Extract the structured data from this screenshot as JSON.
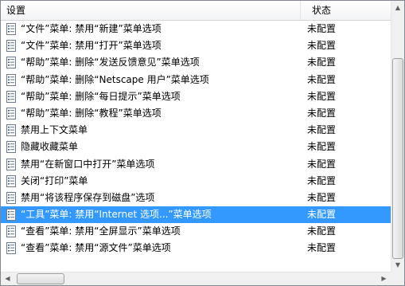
{
  "columns": {
    "setting": "设置",
    "status": "状态"
  },
  "rows": [
    {
      "label": "“文件”菜单: 禁用“新建”菜单选项",
      "status": "未配置"
    },
    {
      "label": "“文件”菜单: 禁用“打开”菜单选项",
      "status": "未配置"
    },
    {
      "label": "“帮助”菜单: 删除“发送反馈意见”菜单选项",
      "status": "未配置"
    },
    {
      "label": "“帮助”菜单: 删除“Netscape 用户”菜单选项",
      "status": "未配置"
    },
    {
      "label": "“帮助”菜单: 删除“每日提示”菜单选项",
      "status": "未配置"
    },
    {
      "label": "“帮助”菜单: 删除“教程”菜单选项",
      "status": "未配置"
    },
    {
      "label": "禁用上下文菜单",
      "status": "未配置"
    },
    {
      "label": "隐藏收藏菜单",
      "status": "未配置"
    },
    {
      "label": "禁用“在新窗口中打开”菜单选项",
      "status": "未配置"
    },
    {
      "label": "关闭“打印”菜单",
      "status": "未配置"
    },
    {
      "label": "禁用“将该程序保存到磁盘”选项",
      "status": "未配置"
    },
    {
      "label": "“工具”菜单: 禁用“Internet 选项...”菜单选项",
      "status": "未配置",
      "selected": true
    },
    {
      "label": "“查看”菜单: 禁用“全屏显示”菜单选项",
      "status": "未配置"
    },
    {
      "label": "“查看”菜单: 禁用“源文件”菜单选项",
      "status": "未配置"
    }
  ],
  "icons": {
    "row_icon": "policy-setting-icon"
  },
  "colors": {
    "selection": "#3399ff"
  }
}
